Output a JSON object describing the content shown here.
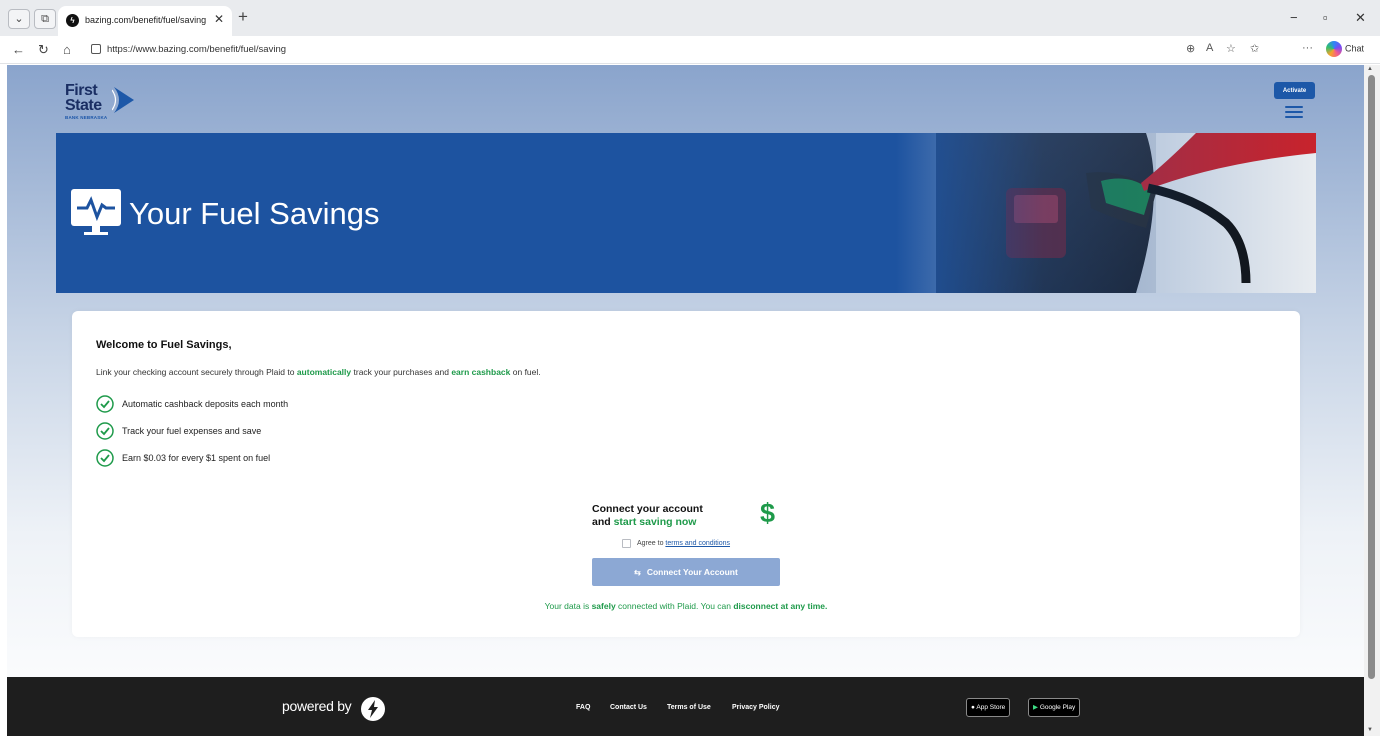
{
  "browser": {
    "tab_title": "bazing.com/benefit/fuel/saving",
    "url": "https://www.bazing.com/benefit/fuel/saving",
    "chat_label": "Chat"
  },
  "header": {
    "logo_line1": "First",
    "logo_line2": "State",
    "logo_sub": "BANK NEBRASKA",
    "activate_label": "Activate"
  },
  "hero": {
    "title": "Your Fuel Savings"
  },
  "card": {
    "welcome": "Welcome to Fuel Savings,",
    "intro_pre": "Link your checking account securely through Plaid to ",
    "intro_hl1": "automatically",
    "intro_mid": " track your purchases and ",
    "intro_hl2": "earn cashback",
    "intro_post": " on fuel.",
    "features": [
      "Automatic cashback deposits each month",
      "Track your fuel expenses and save",
      "Earn $0.03 for every $1 spent on fuel"
    ],
    "connect_line1": "Connect your account",
    "connect_line2_pre": "and ",
    "connect_line2_hl": "start saving now",
    "dollar": "$",
    "agree_pre": "Agree to ",
    "agree_link": "terms and conditions",
    "connect_button": "Connect Your Account",
    "secure_pre": "Your data is ",
    "secure_hl1": "safely",
    "secure_mid": " connected with Plaid. You can ",
    "secure_hl2": "disconnect at any time."
  },
  "footer": {
    "powered_by": "powered by",
    "links": [
      "FAQ",
      "Contact Us",
      "Terms of Use",
      "Privacy Policy"
    ],
    "app_store": "App Store",
    "google_play": "Google Play"
  },
  "colors": {
    "brand_blue": "#1d53a0",
    "accent_green": "#1e9a4a",
    "footer_bg": "#1e1e1e"
  }
}
